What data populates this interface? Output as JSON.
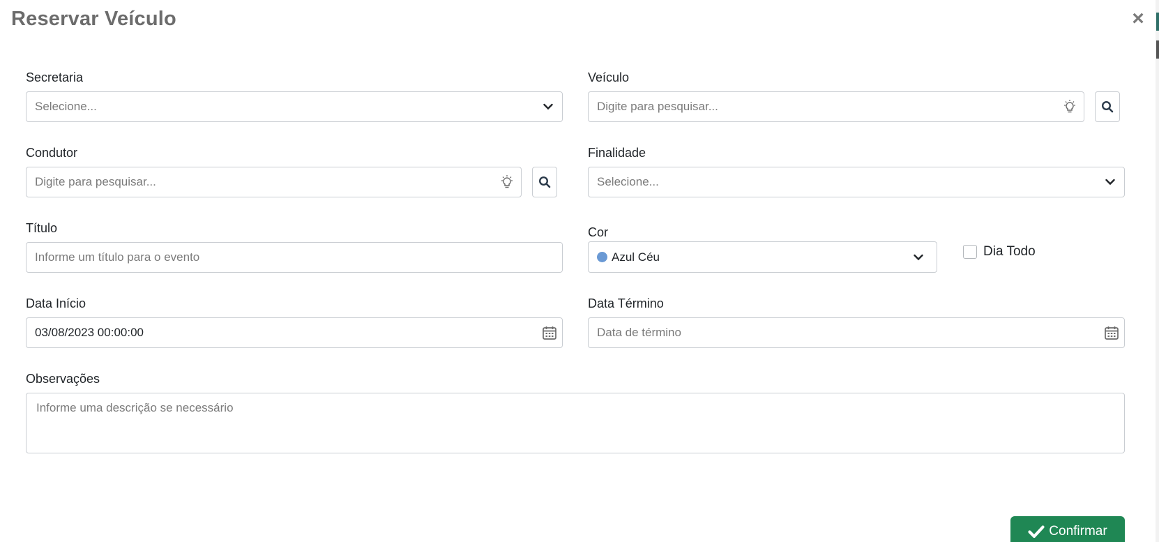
{
  "modal": {
    "title": "Reservar Veículo",
    "close": "×"
  },
  "fields": {
    "secretaria": {
      "label": "Secretaria",
      "value": "Selecione..."
    },
    "veiculo": {
      "label": "Veículo",
      "placeholder": "Digite para pesquisar..."
    },
    "condutor": {
      "label": "Condutor",
      "placeholder": "Digite para pesquisar..."
    },
    "finalidade": {
      "label": "Finalidade",
      "value": "Selecione..."
    },
    "titulo": {
      "label": "Título",
      "placeholder": "Informe um título para o evento"
    },
    "cor": {
      "label": "Cor",
      "value": "Azul Céu",
      "swatch": "#6a99d4"
    },
    "dia_todo": {
      "label": "Dia Todo",
      "checked": false
    },
    "data_inicio": {
      "label": "Data Início",
      "value": "03/08/2023 00:00:00"
    },
    "data_termino": {
      "label": "Data Término",
      "placeholder": "Data de término"
    },
    "observacoes": {
      "label": "Observações",
      "placeholder": "Informe uma descrição se necessário"
    }
  },
  "actions": {
    "confirm": "Confirmar",
    "confirm_color": "#1f8754"
  },
  "icons": {
    "select_caret": "chevron-down-icon",
    "suggestion": "lightbulb-icon",
    "search": "search-icon",
    "calendar": "calendar-icon",
    "confirm": "check-icon"
  }
}
